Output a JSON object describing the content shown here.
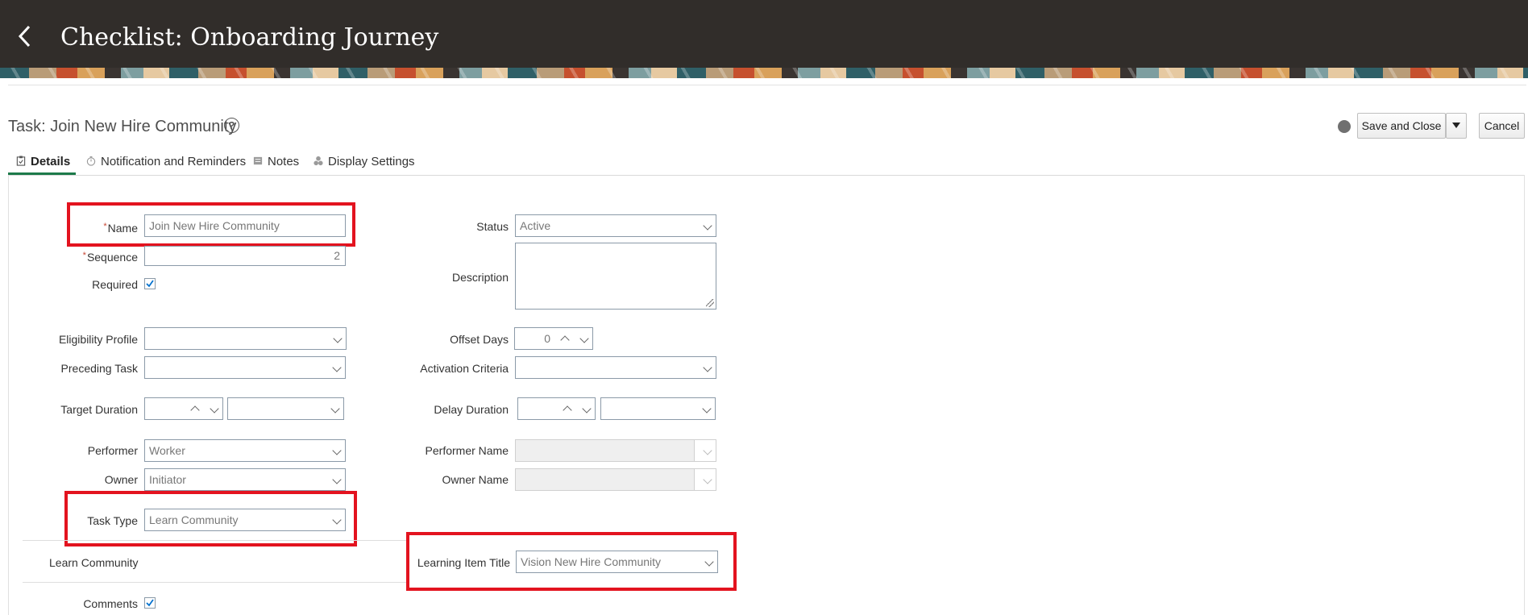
{
  "header": {
    "title": "Checklist: Onboarding Journey"
  },
  "task": {
    "title": "Task: Join New Hire Community"
  },
  "actions": {
    "save_label": "Save and Close",
    "cancel_label": "Cancel"
  },
  "tabs": [
    {
      "label": "Details",
      "active": true
    },
    {
      "label": "Notification and Reminders"
    },
    {
      "label": "Notes"
    },
    {
      "label": "Display Settings"
    }
  ],
  "form": {
    "name": {
      "label": "Name",
      "value": "Join New Hire Community"
    },
    "sequence": {
      "label": "Sequence",
      "value": "2"
    },
    "required": {
      "label": "Required",
      "checked": true
    },
    "status": {
      "label": "Status",
      "value": "Active"
    },
    "description": {
      "label": "Description",
      "value": ""
    },
    "eligibility_profile": {
      "label": "Eligibility Profile",
      "value": ""
    },
    "preceding_task": {
      "label": "Preceding Task",
      "value": ""
    },
    "offset_days": {
      "label": "Offset Days",
      "value": "0"
    },
    "activation_criteria": {
      "label": "Activation Criteria",
      "value": ""
    },
    "target_duration": {
      "label": "Target Duration",
      "value": "",
      "unit": ""
    },
    "delay_duration": {
      "label": "Delay Duration",
      "value": "",
      "unit": ""
    },
    "performer": {
      "label": "Performer",
      "value": "Worker"
    },
    "owner": {
      "label": "Owner",
      "value": "Initiator"
    },
    "performer_name": {
      "label": "Performer Name",
      "value": ""
    },
    "owner_name": {
      "label": "Owner Name",
      "value": ""
    },
    "task_type": {
      "label": "Task Type",
      "value": "Learn Community"
    },
    "section_heading": "Learn Community",
    "learning_item_title": {
      "label": "Learning Item Title",
      "value": "Vision New Hire Community"
    },
    "comments": {
      "label": "Comments",
      "checked": true
    }
  },
  "colors": {
    "header_bg": "#312d2a",
    "highlight": "#e3131f",
    "active_tab": "#1c7a4a",
    "required_marker": "#c74634"
  },
  "icons": [
    "back-chevron-icon",
    "help-icon",
    "globe-icon",
    "dropdown-arrow-icon",
    "clipboard-icon",
    "clock-icon",
    "note-icon",
    "display-settings-icon",
    "checkbox-icon"
  ]
}
